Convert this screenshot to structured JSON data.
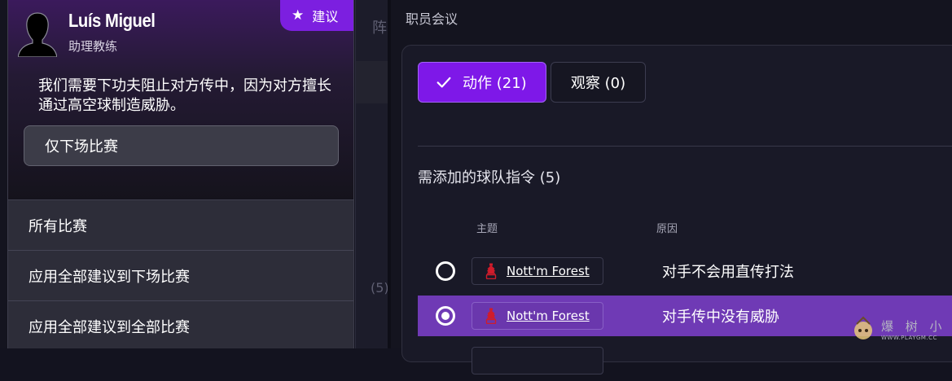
{
  "coach": {
    "name": "Luís Miguel",
    "role": "助理教练",
    "badge": "建议",
    "advice": "我们需要下功夫阻止对方传中，因为对方擅长通过高空球制造威胁。",
    "next_match_button": "仅下场比赛",
    "menu": [
      {
        "label": "所有比赛"
      },
      {
        "label": "应用全部建议到下场比赛"
      },
      {
        "label": "应用全部建议到全部比赛"
      }
    ]
  },
  "background": {
    "fragment_1": "阵",
    "fragment_2": "(5)"
  },
  "staff_meeting": {
    "title": "职员会议",
    "tabs": [
      {
        "label": "动作 (21)",
        "active": true
      },
      {
        "label": "观察 (0)",
        "active": false
      }
    ],
    "section_title": "需添加的球队指令 (5)",
    "columns": {
      "topic": "主题",
      "reason": "原因"
    },
    "rows": [
      {
        "team": "Nott'm Forest",
        "reason": "对手不会用直传打法",
        "selected": false
      },
      {
        "team": "Nott'm Forest",
        "reason": "对手传中没有威胁",
        "selected": true
      }
    ]
  },
  "watermark": {
    "text": "爆 树 小 组",
    "url": "WWW.PLAYGM.CC"
  },
  "colors": {
    "accent": "#7e18e8",
    "selected_row": "#6f3ab5",
    "panel": "#191927",
    "team_red": "#d01c2b"
  }
}
